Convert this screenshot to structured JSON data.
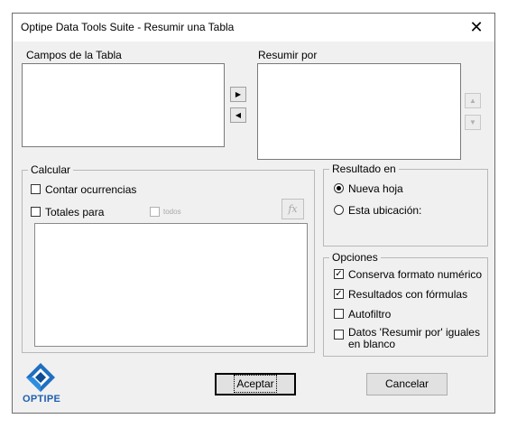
{
  "window": {
    "title": "Optipe Data Tools Suite - Resumir una Tabla"
  },
  "fields": {
    "label": "Campos de la Tabla"
  },
  "summarize": {
    "label": "Resumir por"
  },
  "calc": {
    "legend": "Calcular",
    "count_label": "Contar ocurrencias",
    "totals_label": "Totales para",
    "all_label": "todos",
    "fx_label": "fx"
  },
  "result": {
    "legend": "Resultado en",
    "new_sheet": "Nueva hoja",
    "this_location": "Esta ubicación:"
  },
  "options": {
    "legend": "Opciones",
    "keep_format": "Conserva formato numérico",
    "formulas": "Resultados con fórmulas",
    "autofilter": "Autofiltro",
    "blank_dupes": "Datos 'Resumir por' iguales en blanco"
  },
  "logo": {
    "text": "OPTIPE"
  },
  "buttons": {
    "accept": "Aceptar",
    "cancel": "Cancelar"
  }
}
